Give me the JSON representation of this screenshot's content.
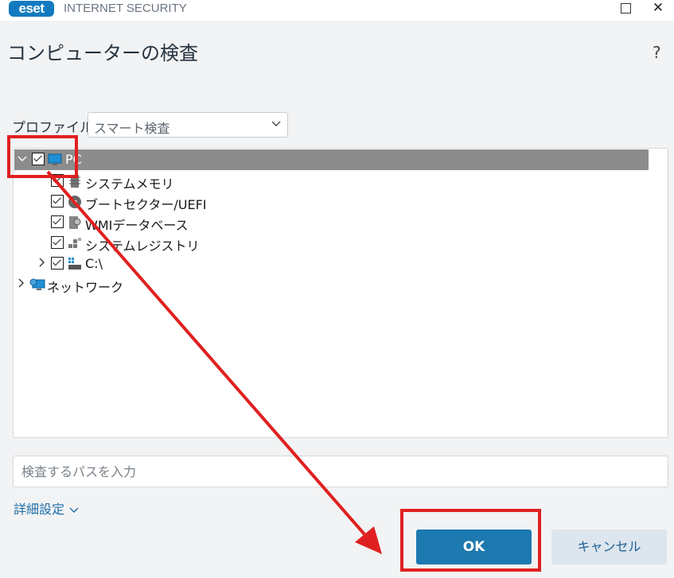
{
  "window": {
    "logo_text": "eset",
    "product_name": "INTERNET SECURITY",
    "brand_color": "#127bbf"
  },
  "page": {
    "title": "コンピューターの検査",
    "help_label": "?"
  },
  "profile": {
    "label": "プロファイル",
    "selected": "スマート検査"
  },
  "tree": {
    "items": [
      {
        "label": "PC",
        "icon": "monitor-icon",
        "checked": true,
        "expanded": true,
        "selected": true
      },
      {
        "label": "システムメモリ",
        "icon": "memory-chip-icon",
        "checked": true
      },
      {
        "label": "ブートセクター/UEFI",
        "icon": "disc-icon",
        "checked": true
      },
      {
        "label": "WMIデータベース",
        "icon": "wmi-database-icon",
        "checked": true
      },
      {
        "label": "システムレジストリ",
        "icon": "registry-icon",
        "checked": true
      },
      {
        "label": "C:\\",
        "icon": "drive-icon",
        "checked": true,
        "expanded": false
      },
      {
        "label": "ネットワーク",
        "icon": "network-icon",
        "expanded": false
      }
    ]
  },
  "path_input": {
    "placeholder": "検査するパスを入力",
    "value": ""
  },
  "advanced": {
    "label": "詳細設定"
  },
  "buttons": {
    "ok": "OK",
    "cancel": "キャンセル"
  },
  "annotation_color": "#e02020"
}
